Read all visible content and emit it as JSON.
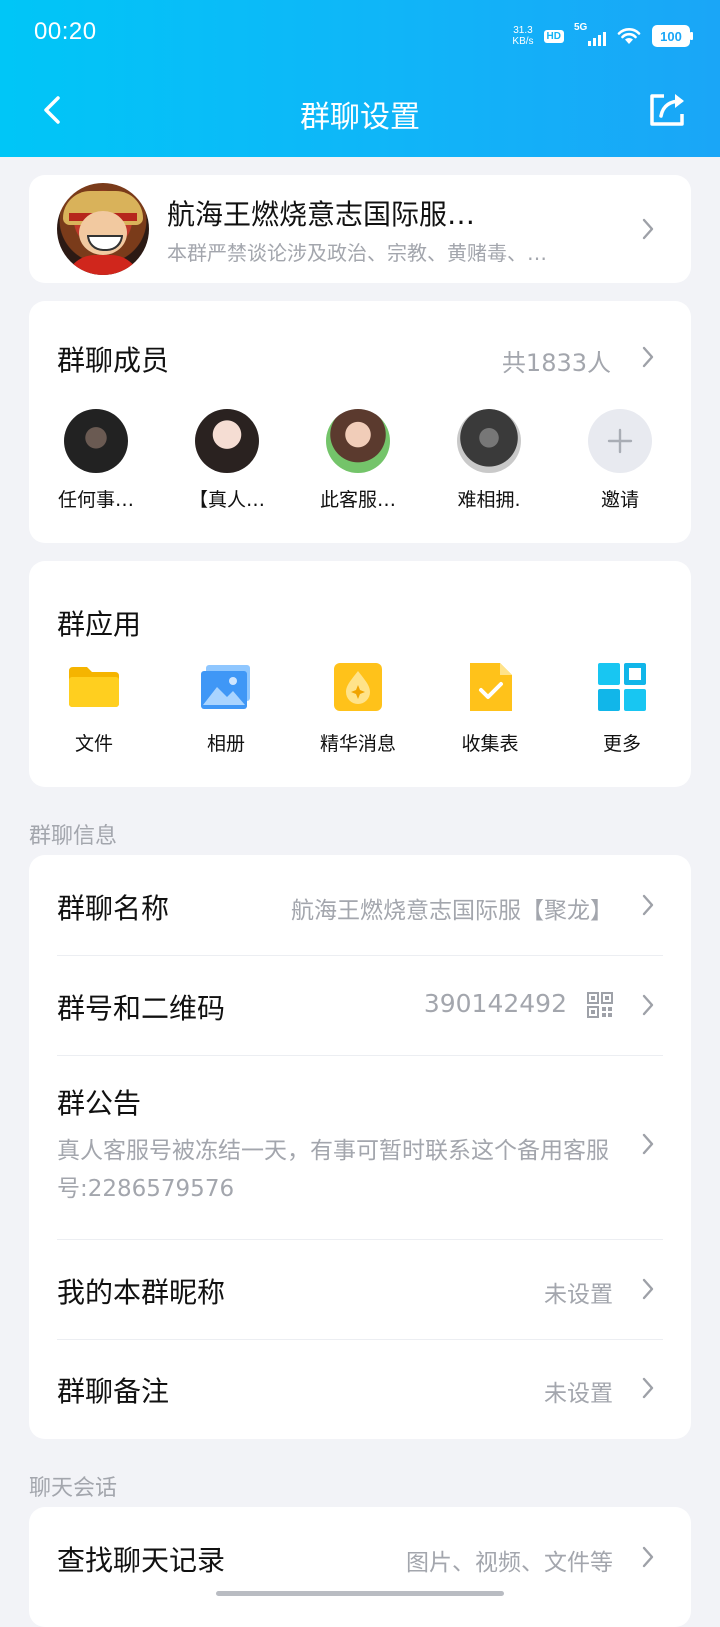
{
  "status_bar": {
    "time": "00:20",
    "net_speed_value": "31.3",
    "net_speed_unit": "KB/s",
    "hd_label": "HD",
    "network_label": "5G",
    "battery": "100"
  },
  "nav": {
    "title": "群聊设置"
  },
  "group": {
    "name": "航海王燃烧意志国际服…",
    "description": "本群严禁谈论涉及政治、宗教、黄赌毒、…"
  },
  "members": {
    "title": "群聊成员",
    "count_label": "共1833人",
    "items": [
      {
        "name": "任何事…"
      },
      {
        "name": "【真人…"
      },
      {
        "name": "此客服…"
      },
      {
        "name": "难相拥."
      }
    ],
    "invite_label": "邀请"
  },
  "apps": {
    "title": "群应用",
    "items": [
      {
        "label": "文件",
        "icon": "folder-icon"
      },
      {
        "label": "相册",
        "icon": "album-icon"
      },
      {
        "label": "精华消息",
        "icon": "essence-icon"
      },
      {
        "label": "收集表",
        "icon": "form-icon"
      },
      {
        "label": "更多",
        "icon": "more-apps-icon"
      }
    ]
  },
  "group_info": {
    "section_label": "群聊信息",
    "name_row": {
      "label": "群聊名称",
      "value": "航海王燃烧意志国际服【聚龙】"
    },
    "id_row": {
      "label": "群号和二维码",
      "value": "390142492"
    },
    "notice_row": {
      "label": "群公告",
      "content": "真人客服号被冻结一天，有事可暂时联系这个备用客服号:2286579576"
    },
    "nickname_row": {
      "label": "我的本群昵称",
      "value": "未设置"
    },
    "remark_row": {
      "label": "群聊备注",
      "value": "未设置"
    }
  },
  "chat": {
    "section_label": "聊天会话",
    "search_row": {
      "label": "查找聊天记录",
      "value": "图片、视频、文件等"
    }
  },
  "colors": {
    "header_gradient_start": "#00c6f7",
    "header_gradient_end": "#1aa6f7",
    "background": "#f2f3f7",
    "secondary_text": "#a3a6ad"
  }
}
